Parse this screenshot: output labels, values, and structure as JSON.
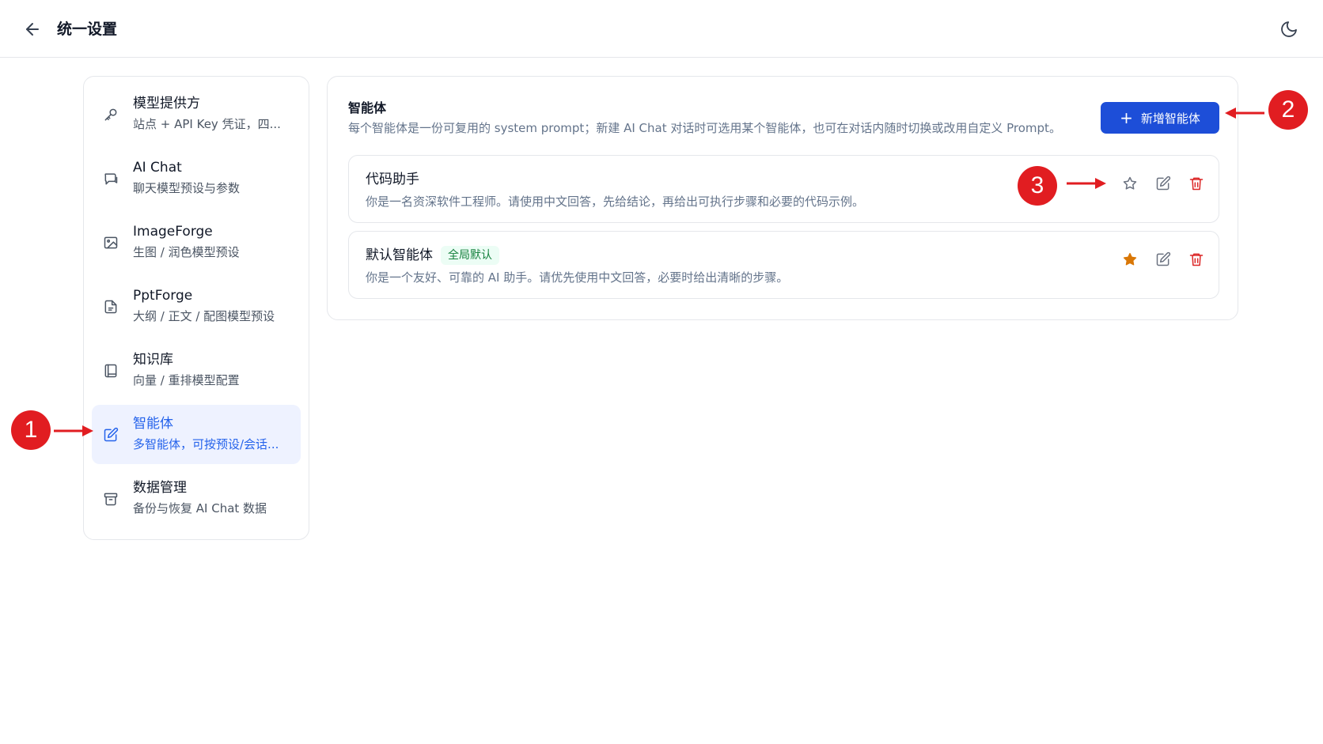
{
  "header": {
    "title": "统一设置",
    "back_icon": "arrow-left-icon",
    "theme_icon": "moon-icon"
  },
  "sidebar": {
    "items": [
      {
        "title": "模型提供方",
        "subtitle": "站点 + API Key 凭证，四...",
        "icon": "key-icon"
      },
      {
        "title": "AI Chat",
        "subtitle": "聊天模型预设与参数",
        "icon": "chat-icon"
      },
      {
        "title": "ImageForge",
        "subtitle": "生图 / 润色模型预设",
        "icon": "image-icon"
      },
      {
        "title": "PptForge",
        "subtitle": "大纲 / 正文 / 配图模型预设",
        "icon": "file-icon"
      },
      {
        "title": "知识库",
        "subtitle": "向量 / 重排模型配置",
        "icon": "book-icon"
      },
      {
        "title": "智能体",
        "subtitle": "多智能体，可按预设/会话...",
        "icon": "edit-icon",
        "active": true
      },
      {
        "title": "数据管理",
        "subtitle": "备份与恢复 AI Chat 数据",
        "icon": "archive-icon"
      }
    ]
  },
  "main": {
    "title": "智能体",
    "description": "每个智能体是一份可复用的 system prompt；新建 AI Chat 对话时可选用某个智能体，也可在对话内随时切换或改用自定义 Prompt。",
    "add_button": "新增智能体",
    "agents": [
      {
        "name": "代码助手",
        "badge": "",
        "description": "你是一名资深软件工程师。请使用中文回答，先给结论，再给出可执行步骤和必要的代码示例。",
        "is_default": false
      },
      {
        "name": "默认智能体",
        "badge": "全局默认",
        "description": "你是一个友好、可靠的 AI 助手。请优先使用中文回答，必要时给出清晰的步骤。",
        "is_default": true
      }
    ]
  },
  "annotations": [
    "1",
    "2",
    "3"
  ],
  "colors": {
    "accent": "#1d4ed8",
    "active_bg": "#eef2ff",
    "annotation": "#e11d21",
    "star_filled": "#d97706",
    "delete": "#dc2626",
    "badge_text": "#15803d"
  }
}
